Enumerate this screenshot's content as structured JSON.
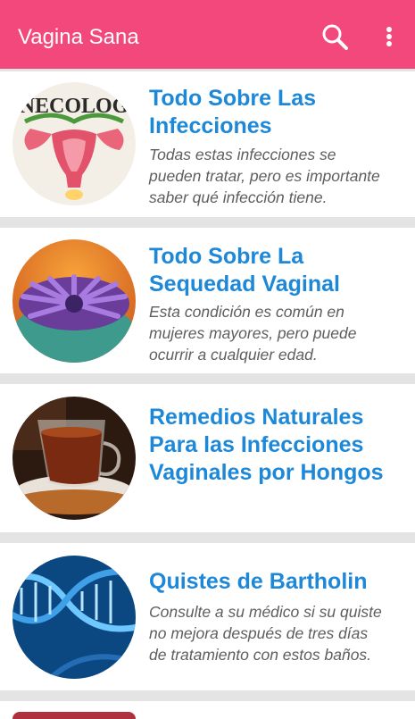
{
  "appbar": {
    "title": "Vagina Sana",
    "search_icon": "search-icon",
    "menu_icon": "more-vert-icon",
    "color": "#f2487c"
  },
  "articles": [
    {
      "title_lines": [
        "Todo Sobre Las",
        "Infecciones"
      ],
      "desc_lines": [
        "Todas estas infecciones se",
        "pueden tratar, pero es importante",
        "saber qué infección tiene."
      ],
      "thumb_text": "NECOLOG"
    },
    {
      "title_lines": [
        "Todo Sobre La",
        "Sequedad Vaginal"
      ],
      "desc_lines": [
        "Esta condición es común en",
        "mujeres mayores, pero puede",
        "ocurrir a cualquier edad."
      ]
    },
    {
      "title_lines": [
        "Remedios Naturales",
        "Para las Infecciones",
        "Vaginales por Hongos"
      ],
      "desc_lines": []
    },
    {
      "title_lines": [
        "Quistes de Bartholin"
      ],
      "desc_lines": [
        "Consulte a su médico si su quiste",
        "no mejora después de tres días",
        "de tratamiento con estos baños."
      ]
    }
  ],
  "colors": {
    "title": "#1e88d8",
    "description": "#5e5e5e",
    "divider": "#e4e4e4"
  }
}
